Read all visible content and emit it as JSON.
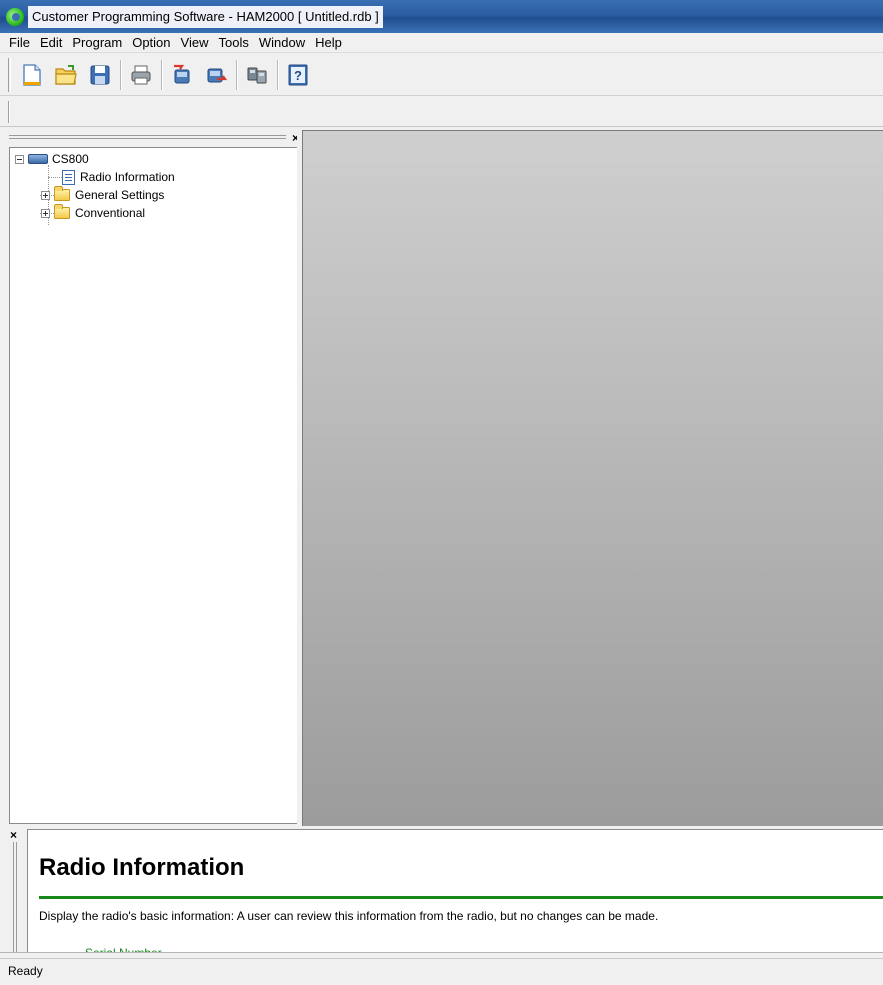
{
  "window": {
    "title": "Customer Programming Software - HAM2000 [ Untitled.rdb ]",
    "app_icon": "cps-logo-icon"
  },
  "menu": {
    "items": [
      {
        "label": "File"
      },
      {
        "label": "Edit"
      },
      {
        "label": "Program"
      },
      {
        "label": "Option"
      },
      {
        "label": "View"
      },
      {
        "label": "Tools"
      },
      {
        "label": "Window"
      },
      {
        "label": "Help"
      }
    ]
  },
  "toolbar": {
    "buttons": [
      {
        "icon": "new-file-icon"
      },
      {
        "icon": "open-folder-icon"
      },
      {
        "icon": "save-disk-icon"
      },
      {
        "icon": "print-icon"
      },
      {
        "icon": "read-from-radio-icon"
      },
      {
        "icon": "write-to-radio-icon"
      },
      {
        "icon": "clone-radio-icon"
      },
      {
        "icon": "help-icon"
      }
    ]
  },
  "tree_panel": {
    "close_glyph": "×",
    "root": {
      "label": "CS800",
      "icon": "radio-icon",
      "expanded": true
    },
    "children": [
      {
        "label": "Radio Information",
        "icon": "document-icon"
      },
      {
        "label": "General Settings",
        "icon": "folder-icon",
        "expandable": true
      },
      {
        "label": "Conventional",
        "icon": "folder-icon",
        "expandable": true
      }
    ]
  },
  "help_panel": {
    "close_glyph": "×",
    "title": "Radio Information",
    "description": "Display the radio's basic information: A user can review this information from the radio, but no changes can be made.",
    "field_label": "Serial Number"
  },
  "status_bar": {
    "text": "Ready"
  },
  "colors": {
    "titlebar": "#2a5da2",
    "mdi_background": "#b5b5b5",
    "help_accent": "#16881b"
  }
}
